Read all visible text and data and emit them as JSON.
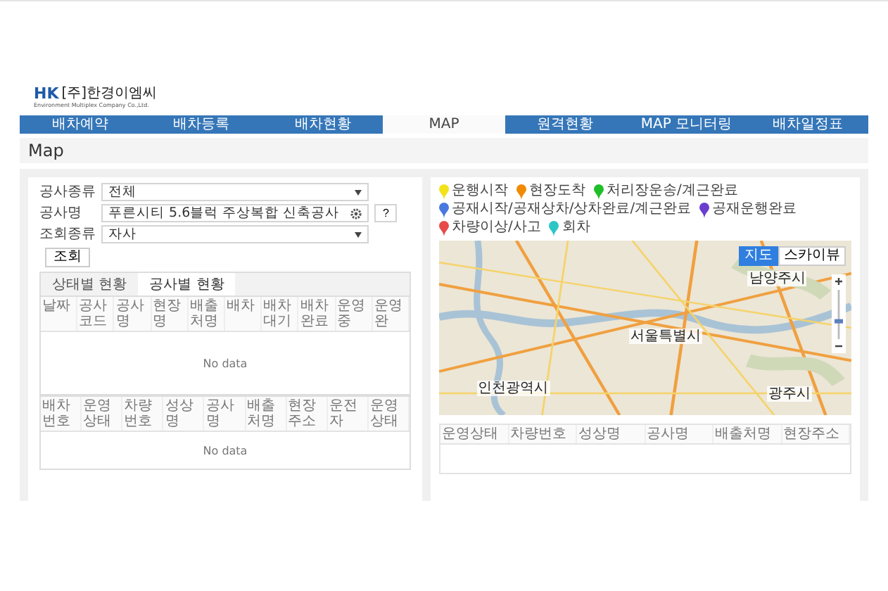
{
  "logo": {
    "mark": "HK",
    "name": "[주]한경이엠씨",
    "tagline": "Environment Multiplex Company Co.,Ltd."
  },
  "nav": [
    {
      "label": "배차예약",
      "selected": false
    },
    {
      "label": "배차등록",
      "selected": false
    },
    {
      "label": "배차현황",
      "selected": false
    },
    {
      "label": "MAP",
      "selected": true
    },
    {
      "label": "원격현황",
      "selected": false
    },
    {
      "label": "MAP 모니터링",
      "selected": false
    },
    {
      "label": "배차일정표",
      "selected": false
    }
  ],
  "page_title": "Map",
  "filters": [
    {
      "label": "공사종류",
      "value": "전체",
      "kind": "select"
    },
    {
      "label": "공사명",
      "value": "푸른시티 5.6블럭 주상복합 신축공사",
      "kind": "search",
      "help": "?"
    },
    {
      "label": "조회종류",
      "value": "자사",
      "kind": "select"
    }
  ],
  "search_button": "조회",
  "tabs": [
    {
      "label": "상태별 현황",
      "selected": false
    },
    {
      "label": "공사별 현황",
      "selected": true
    }
  ],
  "summary_table": {
    "columns": [
      "날짜",
      "공사코드",
      "공사명",
      "현장명",
      "배출처명",
      "배차",
      "배차대기",
      "배차완료",
      "운영중",
      "운영완"
    ],
    "empty_text": "No data"
  },
  "dispatch_table": {
    "columns": [
      "배차번호",
      "운영상태",
      "차량번호",
      "성상명",
      "공사명",
      "배출처명",
      "현장주소",
      "운전자",
      "운영상태"
    ],
    "empty_text": "No data"
  },
  "legend": [
    {
      "label": "운행시작",
      "color": "#f2e21a"
    },
    {
      "label": "현장도착",
      "color": "#f08a00"
    },
    {
      "label": "처리장운송/계근완료",
      "color": "#1fbf2a"
    },
    {
      "label": "공재시작/공재상차/상차완료/계근완료",
      "color": "#4a78e0"
    },
    {
      "label": "공재운행완료",
      "color": "#6a3fd0"
    },
    {
      "label": "차량이상/사고",
      "color": "#e84a4a"
    },
    {
      "label": "회차",
      "color": "#2cc6c6"
    }
  ],
  "map": {
    "view_buttons": [
      {
        "label": "지도",
        "selected": true
      },
      {
        "label": "스카이뷰",
        "selected": false
      }
    ],
    "places": [
      "남양주시",
      "서울특별시",
      "인천광역시",
      "광주시"
    ],
    "zoom": {
      "level": 0.35
    }
  },
  "status_table": {
    "columns": [
      "운영상태",
      "차량번호",
      "성상명",
      "공사명",
      "배출처명",
      "현장주소"
    ]
  }
}
